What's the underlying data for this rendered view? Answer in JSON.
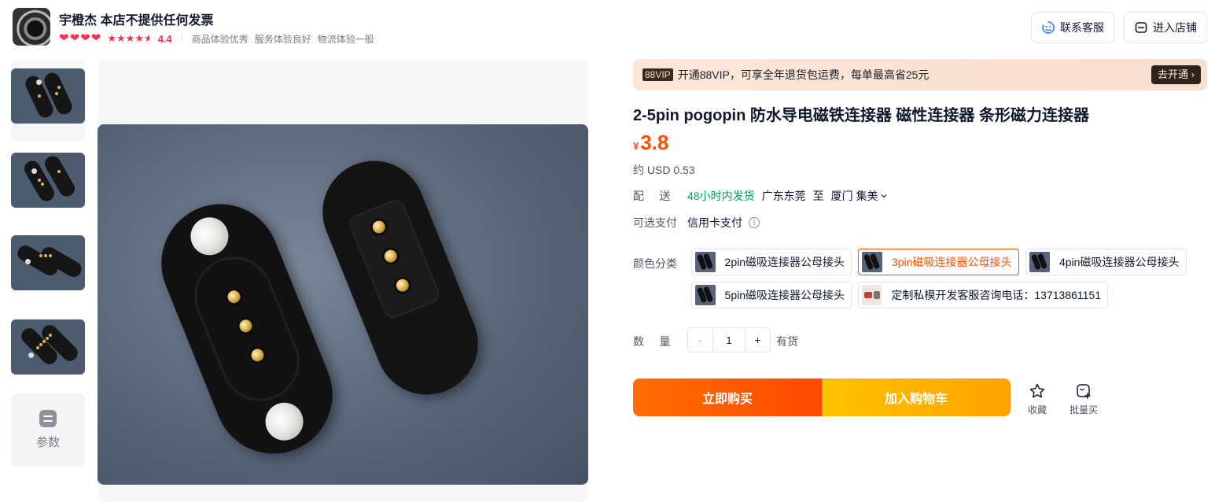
{
  "shop": {
    "name": "宇橙杰 本店不提供任何发票",
    "hearts": 4,
    "stars": 4.5,
    "score": "4.4",
    "experience": [
      "商品体验优秀",
      "服务体验良好",
      "物流体验一般"
    ],
    "service_button": "联系客服",
    "store_button": "进入店铺",
    "service_icon": "smile-face-icon",
    "store_icon": "store-icon"
  },
  "gallery": {
    "params_label": "参数",
    "params_icon": "sliders-icon"
  },
  "vip": {
    "badge": "88VIP",
    "text": "开通88VIP，可享全年退货包运费，每单最高省25元",
    "button": "去开通 ›"
  },
  "product": {
    "title": "2-5pin pogopin 防水导电磁铁连接器 磁性连接器 条形磁力连接器",
    "currency": "¥",
    "price": "3.8",
    "usd": "约 USD 0.53",
    "accent_color": "#ff5000"
  },
  "shipping": {
    "label": "配     送",
    "fast": "48小时内发货",
    "origin": "广东东莞",
    "to": "至",
    "destination": "厦门 集美",
    "fast_color": "#00a05a"
  },
  "payment": {
    "label": "可选支付",
    "method": "信用卡支付",
    "info_icon": "info-circle-icon"
  },
  "sku": {
    "label": "颜色分类",
    "options": [
      {
        "label": "2pin磁吸连接器公母接头",
        "selected": false
      },
      {
        "label": "3pin磁吸连接器公母接头",
        "selected": true
      },
      {
        "label": "4pin磁吸连接器公母接头",
        "selected": false
      },
      {
        "label": "5pin磁吸连接器公母接头",
        "selected": false
      },
      {
        "label": "定制私模开发客服咨询电话：13713861151",
        "selected": false
      }
    ]
  },
  "quantity": {
    "label": "数     量",
    "minus": "-",
    "value": "1",
    "plus": "+",
    "stock": "有货"
  },
  "actions": {
    "buy_now": "立即购买",
    "add_cart": "加入购物车",
    "favorite": "收藏",
    "bulk_buy": "批量买",
    "favorite_icon": "star-outline-icon",
    "bulk_icon": "bulk-cart-icon"
  }
}
